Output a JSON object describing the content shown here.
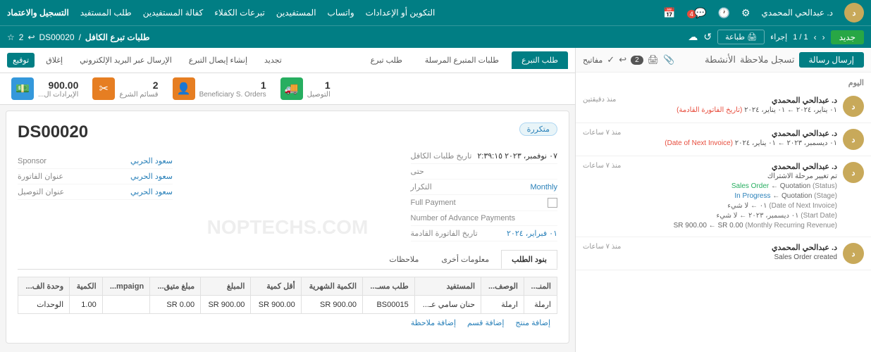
{
  "topnav": {
    "brand": "المستفيدين",
    "links": [
      "التسجيل والاعتماد",
      "طلب المستفيد",
      "كفالة المستفيدين",
      "تبرعات الكفلاء",
      "المستفيدين",
      "واتساب",
      "التكوين أو الإعدادات"
    ],
    "user_name": "د. عبدالحي المحمدي",
    "user_initials": "د",
    "notification_count": "4"
  },
  "subnav": {
    "page_title": "طلبات تبرع الكافل",
    "record_id": "DS00020",
    "pagination": "1 / 1",
    "status": "إجراء",
    "btn_new": "جديد",
    "btn_print": "طباعة",
    "back_count": "2",
    "back_icon": "↩",
    "favorites_label": "مفاتيح"
  },
  "sidebar": {
    "send_btn": "إرسال رسالة",
    "log_btn": "تسجل ملاحظة",
    "activities_btn": "الأنشطة",
    "back_count": "2",
    "section_today": "اليوم",
    "messages": [
      {
        "avatar_color": "#c8a95a",
        "avatar_text": "د",
        "name": "د. عبدالحي المحمدي",
        "time": "منذ دقيقتين",
        "sub": "٠١ يناير، ٢٠٢٤ ← ٠١ يناير، ٢٠٢٤",
        "sub2": "(تاريخ الفاتورة القادمة)",
        "text": ""
      },
      {
        "avatar_color": "#c8a95a",
        "avatar_text": "د",
        "name": "د. عبدالحي المحمدي",
        "time": "منذ ٧ ساعات",
        "sub": "٠١ ديسمبر، ٢٠٢٣ ← ٠١ يناير، ٢٠٢٤",
        "sub2": "(Date of Next Invoice)",
        "text": ""
      },
      {
        "avatar_color": "#c8a95a",
        "avatar_text": "د",
        "name": "د. عبدالحي المحمدي",
        "time": "منذ ٧ ساعات",
        "sub": "تم تغيير مرحلة الاشتراك",
        "status_from_label": "(Status)",
        "status_from": "Quotation",
        "status_arrow": "←",
        "status_to": "Sales Order",
        "stage_label": "(Stage)",
        "stage_from": "Quotation",
        "stage_arrow": "←",
        "stage_to": "In Progress",
        "date_label": "(Date of Next Invoice)",
        "date_from": "لا شيء",
        "date_to": "٠١ ديسمبر، ٢٠٢٣",
        "start_label": "(Start Date)",
        "start_from": "لا شيء",
        "start_to": "٠١ ديسمبر، ٢٠٢٣",
        "revenue_label": "(Monthly Recurring Revenue)",
        "revenue_from": "SR 0.00",
        "revenue_to": "SR 900.00"
      },
      {
        "avatar_color": "#c8a95a",
        "avatar_text": "د",
        "name": "د. عبدالحي المحمدي",
        "time": "منذ ٧ ساعات",
        "sub": "Sales Order created",
        "text": ""
      }
    ]
  },
  "tabs": {
    "items": [
      {
        "label": "طلب التبرع",
        "active": true
      },
      {
        "label": "طلبات المتبرع المرسلة",
        "active": false
      },
      {
        "label": "طلب تبرع",
        "active": false
      }
    ],
    "actions": [
      "تجديد",
      "إنشاء إيصال التبرع",
      "الإرسال عبر البريد الإلكتروني",
      "إغلاق",
      "توقيع"
    ]
  },
  "stats": [
    {
      "icon": "💵",
      "color": "blue",
      "num": "900.00",
      "label": "الإيرادات ال...",
      "currency": ""
    },
    {
      "icon": "✂",
      "color": "orange",
      "num": "2",
      "label": "قسائم الشرع"
    },
    {
      "icon": "👤",
      "color": "orange",
      "num": "1",
      "label": "Beneficiary S. Orders"
    },
    {
      "icon": "🚚",
      "color": "green",
      "num": "1",
      "label": "التوصيل"
    }
  ],
  "form": {
    "badge": "متكررة",
    "title": "DS00020",
    "sponsor_label": "Sponsor",
    "sponsor_value": "سعود الحربي",
    "invoice_address_label": "عنوان الفاتورة",
    "invoice_address_value": "سعود الحربي",
    "delivery_address_label": "عنوان التوصيل",
    "delivery_address_value": "سعود الحربي",
    "date_label": "تاريخ طلبات الكافل",
    "date_value": "٠٧ نوفمبر، ٢٠٢٣  ٢:٣٩:١٥",
    "until_label": "حتى",
    "until_value": "",
    "recurrence_label": "التكرار",
    "recurrence_value": "Monthly",
    "full_payment_label": "Full Payment",
    "full_payment_checked": false,
    "advance_payments_label": "Number of Advance Payments",
    "advance_payments_value": "",
    "next_invoice_label": "تاريخ الفاتورة القادمة",
    "next_invoice_value": "٠١ فبراير، ٢٠٢٤",
    "tabs": [
      "بنود الطلب",
      "معلومات أخرى",
      "ملاحظات"
    ],
    "active_tab": "بنود الطلب",
    "table": {
      "headers": [
        "المنـ...",
        "الوصف...",
        "المستفيد",
        "طلب مسـ...",
        "الكمية الشهرية",
        "أقل كمية",
        "المبلغ",
        "مبلغ متيق...",
        "mpaign...",
        "الكمية",
        "وحدة الف..."
      ],
      "rows": [
        {
          "id": "ارملة",
          "desc": "ارملة",
          "beneficiary": "حنان سامي عـ...",
          "order_ref": "BS00015",
          "monthly_qty": "900.00 SR",
          "min_qty": "900.00 SR",
          "amount": "900.00 SR",
          "amount2": "0.00 SR",
          "campaign": "",
          "qty": "1.00",
          "unit": "الوحدات"
        }
      ],
      "add_product": "إضافة منتج",
      "add_section": "إضافة قسم",
      "add_note": "إضافة ملاحظة"
    }
  }
}
